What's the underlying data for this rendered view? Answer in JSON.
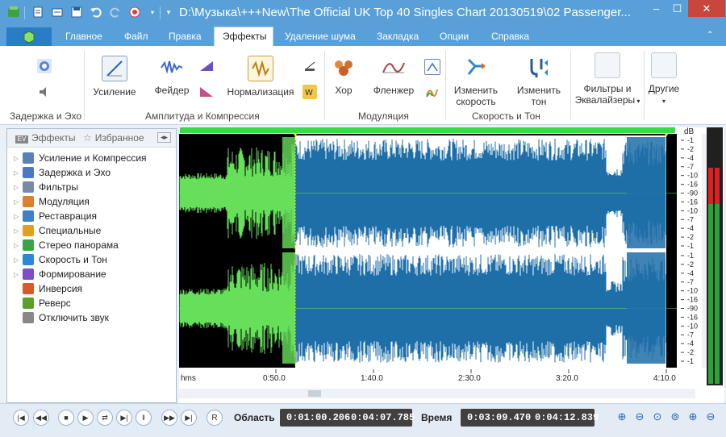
{
  "window": {
    "title": "D:\\Музыка\\+++New\\The Official UK Top 40 Singles Chart 20130519\\02 Passenger...",
    "minimize": "–",
    "maximize": "☐",
    "close": "✕"
  },
  "quick_access": [
    "app-icon",
    "new-file-icon",
    "open-file-icon",
    "save-icon",
    "undo-icon",
    "redo-icon",
    "record-icon",
    "dropdown-icon"
  ],
  "menu_tabs": [
    {
      "label": "Главное"
    },
    {
      "label": "Файл"
    },
    {
      "label": "Правка"
    },
    {
      "label": "Эффекты",
      "active": true
    },
    {
      "label": "Удаление шума"
    },
    {
      "label": "Закладка"
    },
    {
      "label": "Опции"
    },
    {
      "label": "Справка"
    }
  ],
  "ribbon": {
    "groups": [
      {
        "label": "Задержка и Эхо"
      },
      {
        "label": "Амплитуда и Компрессия"
      },
      {
        "label": "Модуляция"
      },
      {
        "label": "Скорость и Тон"
      }
    ],
    "buttons": {
      "gain": "Усиление",
      "fader": "Фейдер",
      "normalize": "Нормализация",
      "chorus": "Хор",
      "flanger": "Фленжер",
      "speed_1": "Изменить",
      "speed_2": "скорость",
      "pitch_1": "Изменить",
      "pitch_2": "тон",
      "filters_1": "Фильтры и",
      "filters_2": "Эквалайзеры",
      "other": "Другие"
    }
  },
  "effects_panel": {
    "tab_effects": "Эффекты",
    "tab_favorites": "Избранное",
    "items": [
      {
        "label": "Усиление и Компрессия",
        "icon": "amplify-icon",
        "color": "#5b7fb8",
        "arrow": true
      },
      {
        "label": "Задержка и Эхо",
        "icon": "echo-icon",
        "color": "#4a78c2",
        "arrow": true
      },
      {
        "label": "Фильтры",
        "icon": "filter-icon",
        "color": "#7a8aa6",
        "arrow": true
      },
      {
        "label": "Модуляция",
        "icon": "modulation-icon",
        "color": "#d9822b",
        "arrow": true
      },
      {
        "label": "Реставрация",
        "icon": "restoration-icon",
        "color": "#3f7fc4",
        "arrow": true
      },
      {
        "label": "Специальные",
        "icon": "special-icon",
        "color": "#e0a020",
        "arrow": true
      },
      {
        "label": "Стерео панорама",
        "icon": "stereo-icon",
        "color": "#3aa34a",
        "arrow": true
      },
      {
        "label": "Скорость и Тон",
        "icon": "speed-icon",
        "color": "#2e86d6",
        "arrow": true
      },
      {
        "label": "Формирование",
        "icon": "shaping-icon",
        "color": "#7c4fc4",
        "arrow": true
      },
      {
        "label": "Инверсия",
        "icon": "invert-icon",
        "color": "#d85a2a",
        "arrow": false
      },
      {
        "label": "Реверс",
        "icon": "reverse-icon",
        "color": "#5aa02a",
        "arrow": false
      },
      {
        "label": "Отключить звук",
        "icon": "mute-icon",
        "color": "#888888",
        "arrow": false
      }
    ]
  },
  "waveform": {
    "time_ticks": [
      "hms",
      "0:50.0",
      "1:40.0",
      "2:30.0",
      "3:20.0",
      "4:10.0"
    ],
    "db_unit": "dB",
    "db_ticks": [
      "-1",
      "-2",
      "-4",
      "-7",
      "-10",
      "-16",
      "-90",
      "-16",
      "-10",
      "-7",
      "-4",
      "-2",
      "-1"
    ],
    "colors": {
      "unselected": "#66e05a",
      "selected": "#1e6ea8",
      "background": "#000000",
      "selection_bg": "#ffffff",
      "top_bar": "#33dd44"
    }
  },
  "transport": {
    "buttons": [
      "go-start-icon",
      "rewind-icon",
      "stop-icon",
      "play-icon",
      "loop-icon",
      "play-selection-icon",
      "pause-icon",
      "forward-icon",
      "go-end-icon",
      "record-icon"
    ],
    "record_label": "R",
    "region_label": "Область",
    "region_start": "0:01:00.206",
    "region_end": "0:04:07.785",
    "time_label": "Время",
    "time_current": "0:03:09.470",
    "time_total": "0:04:12.839"
  },
  "zoom_buttons": [
    "zoom-in-icon",
    "zoom-out-icon",
    "zoom-selection-icon",
    "zoom-fit-icon",
    "zoom-in-vertical-icon",
    "zoom-out-vertical-icon"
  ]
}
